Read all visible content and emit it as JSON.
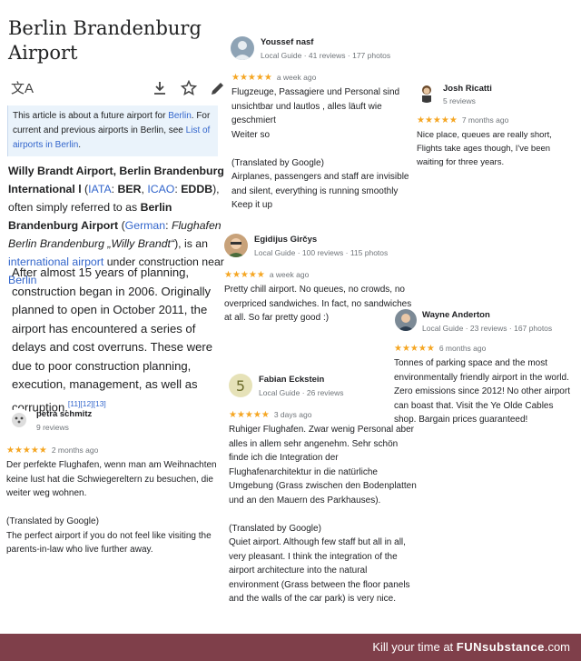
{
  "wiki": {
    "title": "Berlin Brandenburg Airport",
    "hatnote": {
      "t1": "This article is about a future airport for ",
      "link1": "Berlin",
      "t2": ". For current and previous airports in Berlin, see ",
      "link2": "List of airports in Berlin",
      "t3": "."
    },
    "lead": {
      "b1": "Willy Brandt Airport, Berlin Brandenburg International l",
      "t1": " (",
      "iata_link": "IATA",
      "t2": ": ",
      "iata_code": "BER",
      "t3": ", ",
      "icao_link": "ICAO",
      "t4": ": ",
      "icao_code": "EDDB",
      "t5": "), often simply referred to as ",
      "b2": "Berlin Brandenburg Airport",
      "t6": " (",
      "german_link": "German",
      "t7": ": ",
      "german_name": "Flughafen Berlin Brandenburg „Willy Brandt“",
      "t8": "), is an ",
      "intl_link": "international airport",
      "t9": " under construction near ",
      "berlin_link": "Berlin"
    },
    "history": "After almost 15 years of planning, construction began in 2006. Originally planned to open in October 2011, the airport has encountered a series of delays and cost overruns. These were due to poor construction planning, execution, management, as well as corruption.",
    "citations": "[11][12][13]"
  },
  "reviews": {
    "youssef": {
      "name": "Youssef nasf",
      "meta": "Local Guide · 41 reviews · 177 photos",
      "stars": "★★★★★",
      "ago": "a week ago",
      "text": "Flugzeuge, Passagiere und Personal  sind unsichtbar und lautlos , alles läuft wie geschmiert\nWeiter so\n\n(Translated by Google)\nAirplanes, passengers and staff are invisible and silent, everything is running smoothly\nKeep it up"
    },
    "josh": {
      "name": "Josh Ricatti",
      "meta": "5 reviews",
      "stars": "★★★★★",
      "ago": "7 months ago",
      "text": "Nice place, queues are really short, Flights take ages though, I've been waiting for three years."
    },
    "egidijus": {
      "name": "Egidijus Girčys",
      "meta": "Local Guide · 100 reviews · 115 photos",
      "stars": "★★★★★",
      "ago": "a week ago",
      "text": "Pretty chill airport. No queues, no crowds, no overpriced sandwiches. In fact, no sandwiches at all. So far pretty good :)"
    },
    "wayne": {
      "name": "Wayne Anderton",
      "meta": "Local Guide · 23 reviews · 167 photos",
      "stars": "★★★★★",
      "ago": "6 months ago",
      "text": "Tonnes of parking space and the most environmentally friendly airport in the world. Zero emissions since 2012!  No other airport can boast that.  Visit the Ye Olde Cables shop. Bargain prices guaranteed!"
    },
    "fabian": {
      "name": "Fabian Eckstein",
      "meta": "Local Guide · 26 reviews",
      "stars": "★★★★★",
      "ago": "3 days ago",
      "text": "Ruhiger Flughafen. Zwar wenig Personal aber alles in allem sehr angenehm. Sehr schön finde ich die Integration der Flughafenarchitektur in die natürliche Umgebung (Grass zwischen den Bodenplatten und an den Mauern des Parkhauses).\n\n(Translated by Google)\nQuiet airport. Although few staff but all in all, very pleasant. I think the integration of the airport architecture into the natural environment (Grass between the floor panels and the walls of the car park) is very nice."
    },
    "petra": {
      "name": "petra schmitz",
      "meta": "9 reviews",
      "stars": "★★★★★",
      "ago": "2 months ago",
      "text": "Der perfekte Flughafen, wenn man am Weihnachten keine lust hat die Schwiegereltern zu besuchen, die weiter weg wohnen.\n\n(Translated by Google)\nThe perfect airport if you do not feel like visiting the parents-in-law who live further away."
    }
  },
  "footer": {
    "prefix": "Kill your time at ",
    "brand": "FUNsubstance",
    "suffix": ".com"
  }
}
